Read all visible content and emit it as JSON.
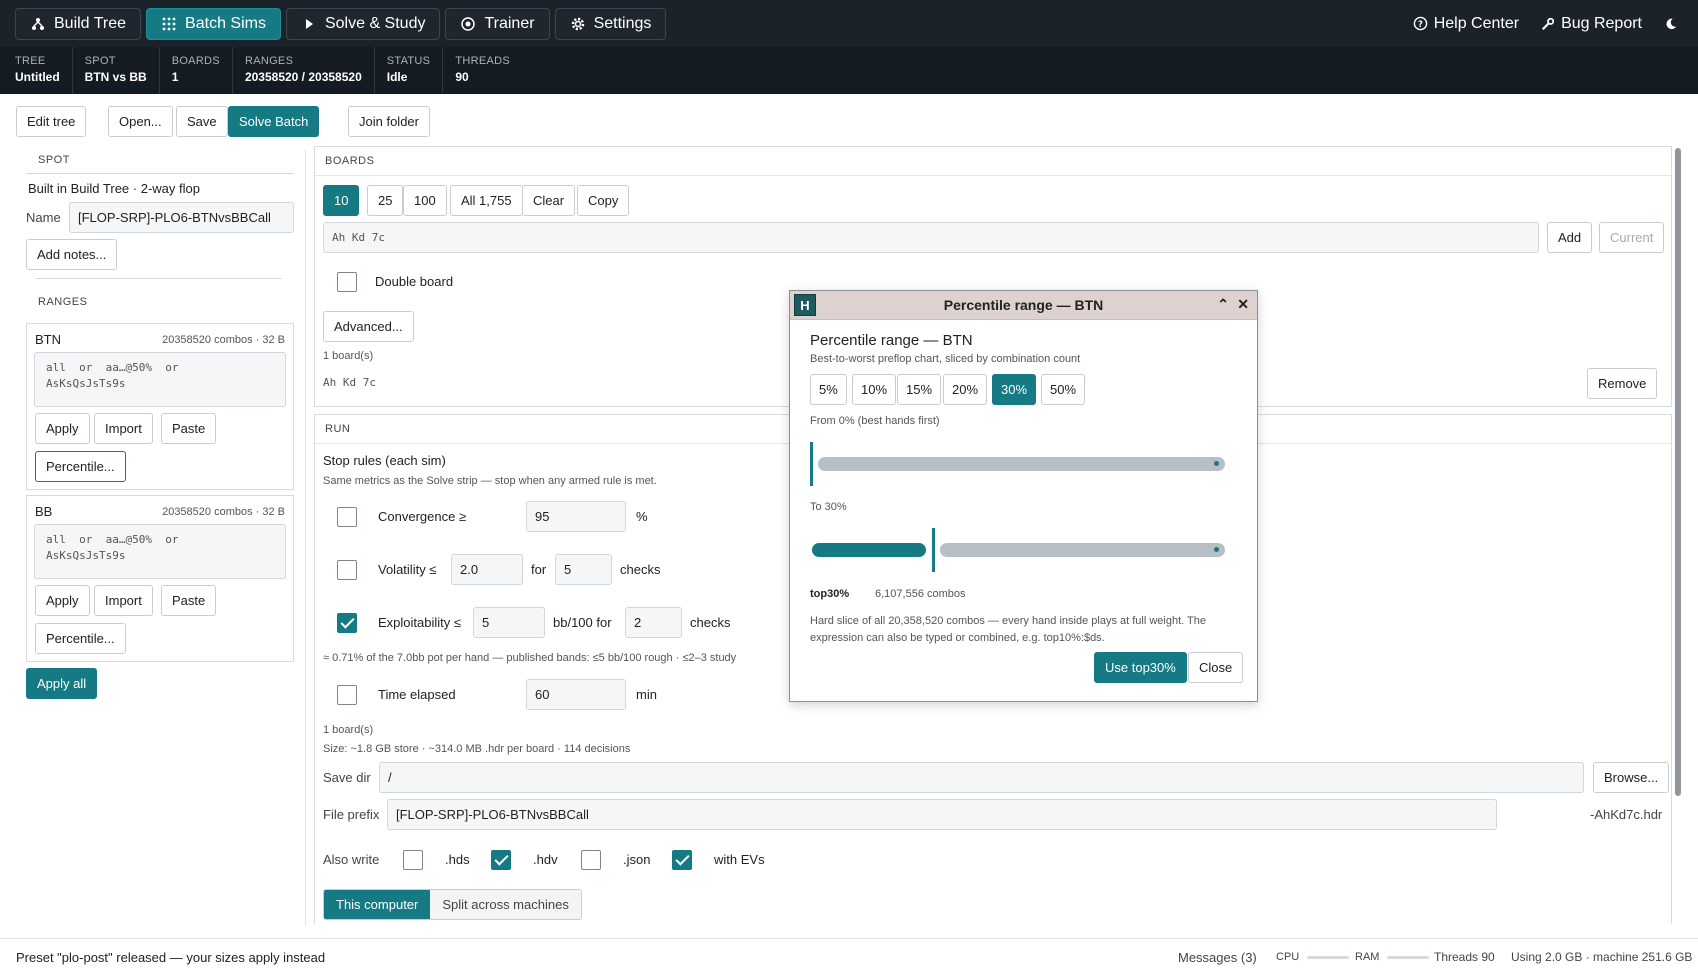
{
  "nav": {
    "tabs": [
      {
        "label": "Build Tree",
        "icon": "tree-icon"
      },
      {
        "label": "Batch Sims",
        "icon": "grid-icon"
      },
      {
        "label": "Solve & Study",
        "icon": "play-icon"
      },
      {
        "label": "Trainer",
        "icon": "target-icon"
      },
      {
        "label": "Settings",
        "icon": "gear-icon"
      }
    ],
    "active_tab": "Batch Sims",
    "help": "Help Center",
    "bug": "Bug Report"
  },
  "status": [
    {
      "label": "TREE",
      "value": "Untitled"
    },
    {
      "label": "SPOT",
      "value": "BTN vs BB"
    },
    {
      "label": "BOARDS",
      "value": "1"
    },
    {
      "label": "RANGES",
      "value": "20358520 / 20358520"
    },
    {
      "label": "STATUS",
      "value": "Idle"
    },
    {
      "label": "THREADS",
      "value": "90"
    }
  ],
  "toolbar": {
    "edit_tree": "Edit tree",
    "open": "Open...",
    "save": "Save",
    "solve_batch": "Solve Batch",
    "join_folder": "Join folder"
  },
  "spot": {
    "header": "SPOT",
    "built": "Built in Build Tree · 2-way flop",
    "name_label": "Name",
    "name_value": "[FLOP-SRP]-PLO6-BTNvsBBCall",
    "add_notes": "Add notes..."
  },
  "ranges": {
    "header": "RANGES",
    "items": [
      {
        "name": "BTN",
        "info": "20358520 combos · 32 B",
        "expr": "all  or  aa…@50%  or\nAsKsQsJsTs9s",
        "apply": "Apply",
        "import": "Import",
        "paste": "Paste",
        "percentile": "Percentile..."
      },
      {
        "name": "BB",
        "info": "20358520 combos · 32 B",
        "expr": "all  or  aa…@50%  or\nAsKsQsJsTs9s",
        "apply": "Apply",
        "import": "Import",
        "paste": "Paste",
        "percentile": "Percentile..."
      }
    ],
    "apply_all": "Apply all"
  },
  "boards": {
    "header": "BOARDS",
    "presets": [
      "10",
      "25",
      "100",
      "All 1,755",
      "Clear",
      "Copy"
    ],
    "active_preset": "10",
    "input_value": "Ah Kd 7c",
    "add": "Add",
    "current": "Current",
    "double_board": "Double board",
    "advanced": "Advanced...",
    "count": "1 board(s)",
    "board_item": "Ah Kd 7c",
    "remove": "Remove"
  },
  "run": {
    "header": "RUN",
    "stop_title": "Stop rules (each sim)",
    "stop_sub": "Same metrics as the Solve strip — stop when any armed rule is met.",
    "convergence": {
      "label": "Convergence ≥",
      "value": "95",
      "unit": "%",
      "checked": false
    },
    "volatility": {
      "label": "Volatility ≤",
      "value": "2.0",
      "for": "for",
      "checks_value": "5",
      "unit": "checks",
      "checked": false
    },
    "exploitability": {
      "label": "Exploitability ≤",
      "value": "5",
      "unit": "bb/100 for",
      "checks_value": "2",
      "checks": "checks",
      "checked": true
    },
    "expl_note": "≈ 0.71% of the 7.0bb pot per hand — published bands: ≤5 bb/100 rough · ≤2–3 study",
    "time": {
      "label": "Time elapsed",
      "value": "60",
      "unit": "min",
      "checked": false
    },
    "boards_count": "1 board(s)",
    "size_note": "Size: ~1.8 GB store · ~314.0 MB .hdr per board · 114 decisions",
    "save_dir_label": "Save dir",
    "save_dir_value": "/",
    "browse": "Browse...",
    "prefix_label": "File prefix",
    "prefix_value": "[FLOP-SRP]-PLO6-BTNvsBBCall",
    "prefix_suffix": "-AhKd7c.hdr",
    "also_write": "Also write",
    "outputs": [
      {
        "label": ".hds",
        "checked": false
      },
      {
        "label": ".hdv",
        "checked": true
      },
      {
        "label": ".json",
        "checked": false
      },
      {
        "label": "with EVs",
        "checked": true
      }
    ],
    "mode_local": "This computer",
    "mode_split": "Split across machines"
  },
  "modal": {
    "window_title": "Percentile range — BTN",
    "title": "Percentile range — BTN",
    "subtitle": "Best-to-worst preflop chart, sliced by combination count",
    "presets": [
      "5%",
      "10%",
      "15%",
      "20%",
      "30%",
      "50%"
    ],
    "active_preset": "30%",
    "from_label": "From 0% (best hands first)",
    "from_value": 0,
    "to_label": "To 30%",
    "to_value": 0.3,
    "result_expr": "top30%",
    "result_combos": "6,107,556 combos",
    "desc": "Hard slice of all 20,358,520 combos — every hand inside plays at full weight. The expression can also be typed or combined, e.g. top10%:$ds.",
    "use": "Use top30%",
    "close": "Close"
  },
  "footer": {
    "message": "Preset \"plo-post\" released — your sizes apply instead",
    "messages": "Messages (3)",
    "cpu": "CPU",
    "ram": "RAM",
    "threads": "Threads 90",
    "using": "Using 2.0 GB · machine 251.6 GB"
  }
}
